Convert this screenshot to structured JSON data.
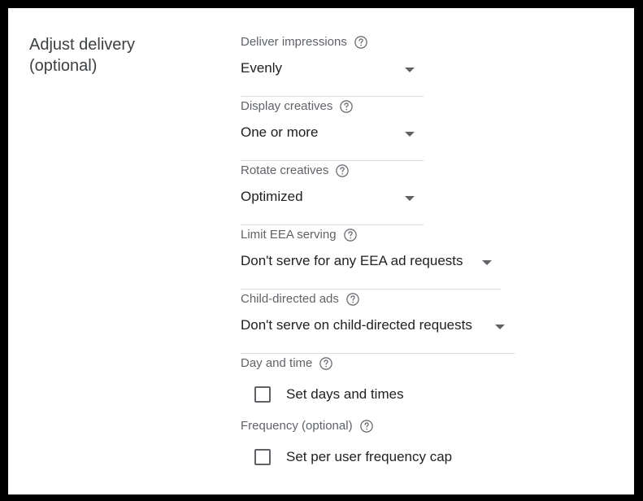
{
  "section": {
    "title_line1": "Adjust delivery",
    "title_line2": "(optional)"
  },
  "fields": {
    "deliver_impressions": {
      "label": "Deliver impressions",
      "value": "Evenly"
    },
    "display_creatives": {
      "label": "Display creatives",
      "value": "One or more"
    },
    "rotate_creatives": {
      "label": "Rotate creatives",
      "value": "Optimized"
    },
    "limit_eea_serving": {
      "label": "Limit EEA serving",
      "value": "Don't serve for any EEA ad requests"
    },
    "child_directed_ads": {
      "label": "Child-directed ads",
      "value": "Don't serve on child-directed requests"
    },
    "day_and_time": {
      "label": "Day and time",
      "checkbox_label": "Set days and times",
      "checked": false
    },
    "frequency": {
      "label": "Frequency (optional)",
      "checkbox_label": "Set per user frequency cap",
      "checked": false
    }
  },
  "icons": {
    "help": "help-circle-icon",
    "dropdown": "arrow-drop-down-icon"
  },
  "colors": {
    "frame": "#000000",
    "background": "#ffffff",
    "title_text": "#3c4043",
    "label_text": "#5f6368",
    "value_text": "#202124",
    "divider": "#dadce0"
  }
}
